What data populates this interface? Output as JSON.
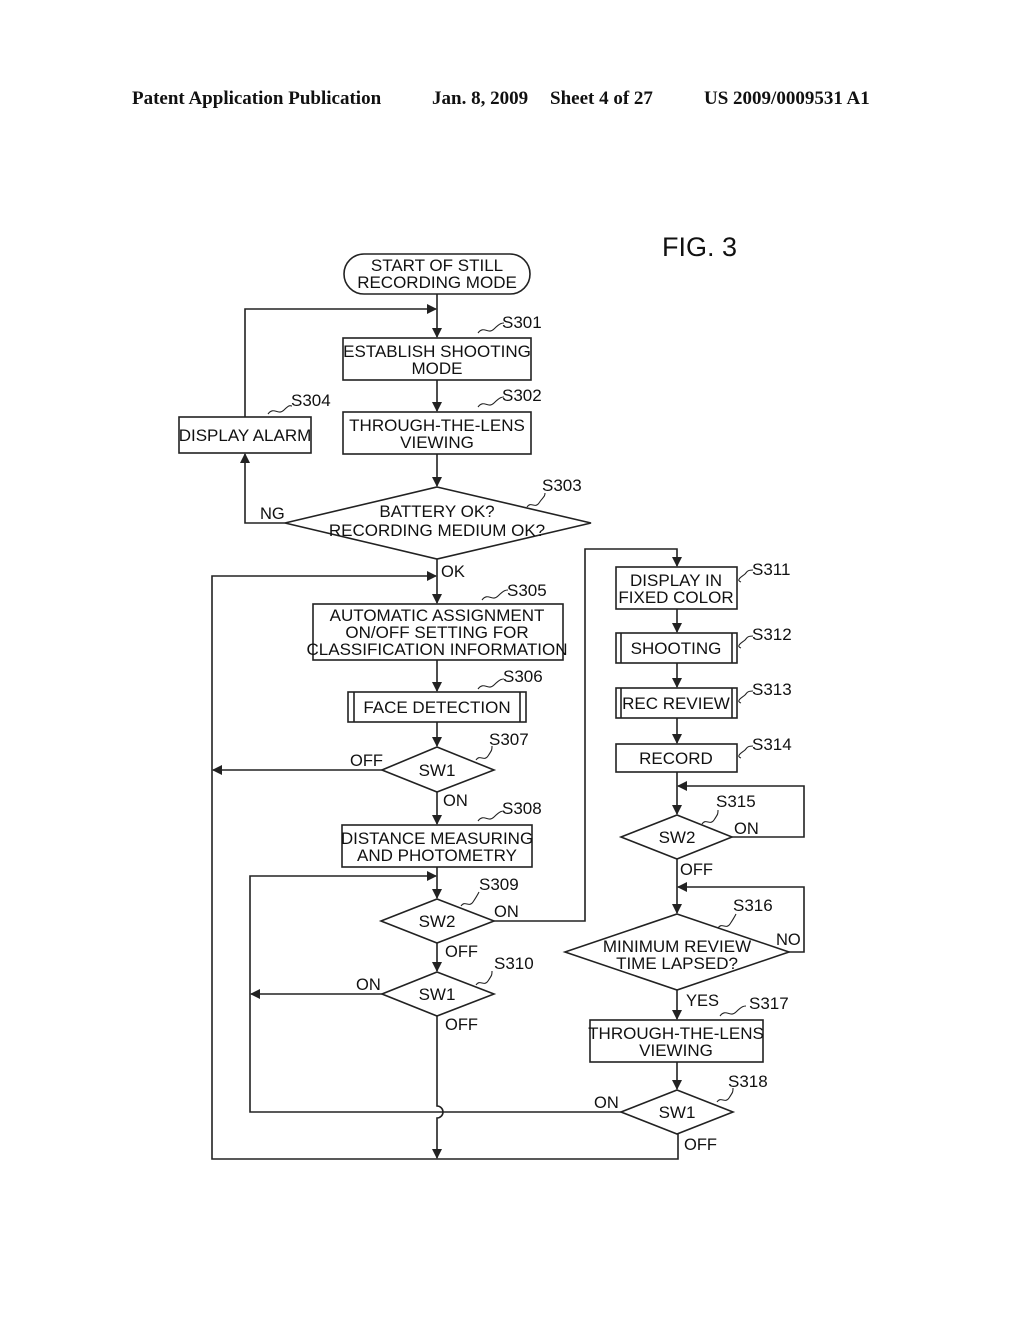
{
  "header": {
    "publication": "Patent Application Publication",
    "date": "Jan. 8, 2009",
    "sheet": "Sheet 4 of 27",
    "number": "US 2009/0009531 A1"
  },
  "figure": {
    "title": "FIG. 3"
  },
  "nodes": {
    "start": {
      "lines": [
        "START OF STILL",
        "RECORDING MODE"
      ]
    },
    "s301": {
      "step": "S301",
      "lines": [
        "ESTABLISH SHOOTING",
        "MODE"
      ]
    },
    "s302": {
      "step": "S302",
      "lines": [
        "THROUGH-THE-LENS",
        "VIEWING"
      ]
    },
    "s303": {
      "step": "S303",
      "lines": [
        "BATTERY OK?",
        "RECORDING MEDIUM OK?"
      ]
    },
    "s304": {
      "step": "S304",
      "lines": [
        "DISPLAY ALARM"
      ]
    },
    "s305": {
      "step": "S305",
      "lines": [
        "AUTOMATIC ASSIGNMENT",
        "ON/OFF SETTING FOR",
        "CLASSIFICATION INFORMATION"
      ]
    },
    "s306": {
      "step": "S306",
      "lines": [
        "FACE DETECTION"
      ]
    },
    "s307": {
      "step": "S307",
      "lines": [
        "SW1"
      ]
    },
    "s308": {
      "step": "S308",
      "lines": [
        "DISTANCE MEASURING",
        "AND PHOTOMETRY"
      ]
    },
    "s309": {
      "step": "S309",
      "lines": [
        "SW2"
      ]
    },
    "s310": {
      "step": "S310",
      "lines": [
        "SW1"
      ]
    },
    "s311": {
      "step": "S311",
      "lines": [
        "DISPLAY IN",
        "FIXED COLOR"
      ]
    },
    "s312": {
      "step": "S312",
      "lines": [
        "SHOOTING"
      ]
    },
    "s313": {
      "step": "S313",
      "lines": [
        "REC REVIEW"
      ]
    },
    "s314": {
      "step": "S314",
      "lines": [
        "RECORD"
      ]
    },
    "s315": {
      "step": "S315",
      "lines": [
        "SW2"
      ]
    },
    "s316": {
      "step": "S316",
      "lines": [
        "MINIMUM REVIEW",
        "TIME LAPSED?"
      ]
    },
    "s317": {
      "step": "S317",
      "lines": [
        "THROUGH-THE-LENS",
        "VIEWING"
      ]
    },
    "s318": {
      "step": "S318",
      "lines": [
        "SW1"
      ]
    }
  },
  "branch_labels": {
    "s303_ng": "NG",
    "s303_ok": "OK",
    "s307_off": "OFF",
    "s307_on": "ON",
    "s309_on": "ON",
    "s309_off": "OFF",
    "s310_on": "ON",
    "s310_off": "OFF",
    "s315_on": "ON",
    "s315_off": "OFF",
    "s316_no": "NO",
    "s316_yes": "YES",
    "s318_on": "ON",
    "s318_off": "OFF"
  }
}
